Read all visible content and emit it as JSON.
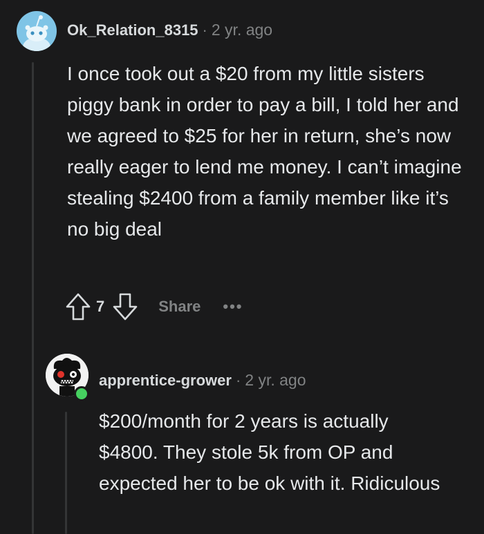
{
  "comments": [
    {
      "username": "Ok_Relation_8315",
      "separator": "·",
      "time": "2 yr. ago",
      "body": "I once took out a $20 from my little sisters piggy bank in order to pay a bill, I told her and we agreed to $25 for her in return, she’s now really eager to lend me money. I can’t imagine stealing $2400 from a family member like it’s no big deal",
      "votes": "7",
      "share_label": "Share",
      "more_label": "•••",
      "avatar_icon": "snoo-avatar-icon"
    },
    {
      "username": "apprentice-grower",
      "separator": "·",
      "time": "2 yr. ago",
      "body": "$200/month for 2 years is actually $4800. They stole 5k from OP and expected her to be ok with it. Ridiculous",
      "avatar_icon": "custom-avatar-icon"
    }
  ],
  "colors": {
    "background": "#1a1a1b",
    "avatar_bg": "#7fc4e6",
    "online": "#46d160"
  }
}
